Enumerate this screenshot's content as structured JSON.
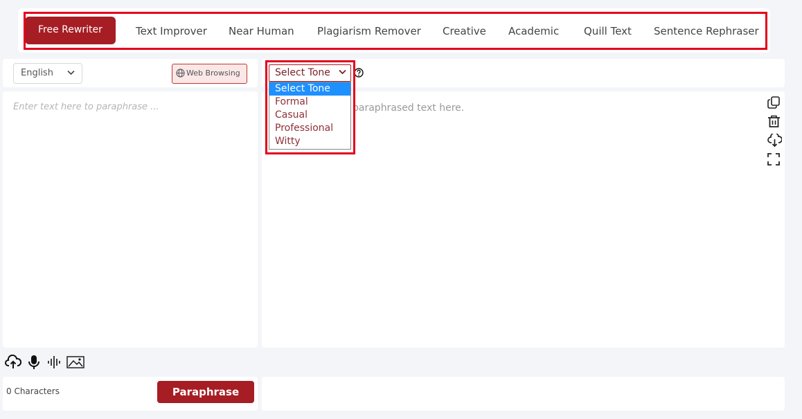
{
  "tabs": [
    {
      "label": "Free Rewriter",
      "active": true
    },
    {
      "label": "Text Improver",
      "active": false
    },
    {
      "label": "Near Human",
      "active": false
    },
    {
      "label": "Plagiarism Remover",
      "active": false
    },
    {
      "label": "Creative",
      "active": false
    },
    {
      "label": "Academic",
      "active": false
    },
    {
      "label": "Quill Text",
      "active": false
    },
    {
      "label": "Sentence Rephraser",
      "active": false
    }
  ],
  "input": {
    "language": "English",
    "web_browsing_label": "Web Browsing",
    "placeholder": "Enter text here to paraphrase ...",
    "char_count": "0 Characters",
    "paraphrase_label": "Paraphrase"
  },
  "output": {
    "placeholder": "paraphrased text here.",
    "tone": {
      "selected": "Select Tone",
      "options": [
        "Select Tone",
        "Formal",
        "Casual",
        "Professional",
        "Witty"
      ]
    }
  },
  "icons": {
    "output_tools": [
      "copy-icon",
      "trash-icon",
      "download-icon",
      "fullscreen-icon"
    ],
    "input_tools": [
      "upload-icon",
      "microphone-icon",
      "audio-wave-icon",
      "image-icon"
    ]
  },
  "colors": {
    "accent": "#a61d24",
    "highlight_outline": "#e3001b",
    "selected_option": "#1e90ff"
  }
}
